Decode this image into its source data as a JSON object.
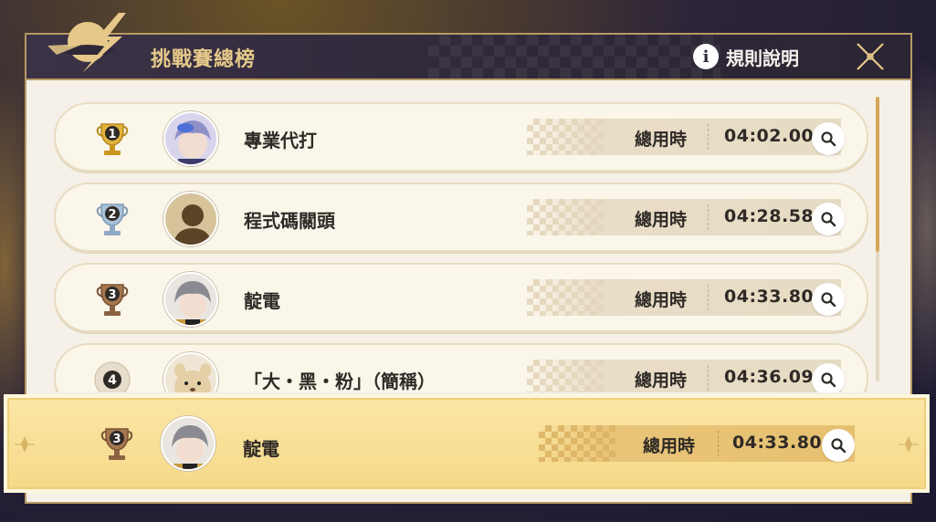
{
  "header": {
    "title": "挑戰賽總榜",
    "rules_label": "規則說明"
  },
  "leaderboard": [
    {
      "rank": "1",
      "name": "專業代打",
      "time_label": "總用時",
      "time": "04:02.00",
      "badge_color": "#e2b33a"
    },
    {
      "rank": "2",
      "name": "程式碼關頭",
      "time_label": "總用時",
      "time": "04:28.58",
      "badge_color": "#9fb7cf"
    },
    {
      "rank": "3",
      "name": "靛電",
      "time_label": "總用時",
      "time": "04:33.80",
      "badge_color": "#a0714b"
    },
    {
      "rank": "4",
      "name": "「大・黑・粉」（簡稱）",
      "time_label": "總用時",
      "time": "04:36.09",
      "badge_color": "#dcd3c3"
    }
  ],
  "my_entry": {
    "rank": "3",
    "name": "靛電",
    "time_label": "總用時",
    "time": "04:33.80",
    "badge_color": "#a0714b"
  },
  "icons": {
    "info": "info-icon",
    "close": "close-icon",
    "search": "search-icon",
    "trophy": "trophy-icon"
  },
  "colors": {
    "header_bg": "#2e2838",
    "title_gold": "#e6c98a",
    "highlight_row": "#f6d98a",
    "accent": "#d5a75a"
  }
}
